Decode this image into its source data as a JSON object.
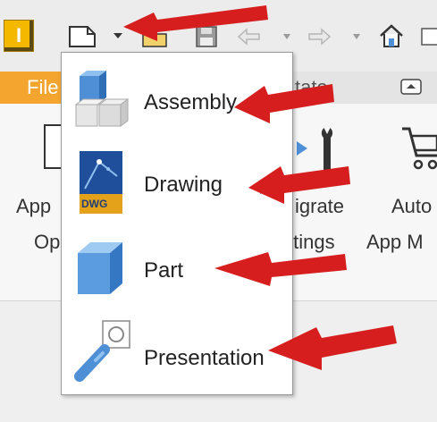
{
  "app": {
    "logo_letter": "I"
  },
  "ribbon": {
    "file_tab": "File",
    "tab_partial": "tate",
    "buttons": [
      {
        "line1": "App",
        "line2": "Op"
      },
      {
        "line1": "igrate",
        "line2": "ttings"
      },
      {
        "line1": "Auto",
        "line2": "App M"
      }
    ]
  },
  "new_menu": {
    "items": [
      {
        "label": "Assembly",
        "icon": "assembly-icon"
      },
      {
        "label": "Drawing",
        "icon": "drawing-icon",
        "badge": "DWG",
        "has_submenu": true
      },
      {
        "label": "Part",
        "icon": "part-icon"
      },
      {
        "label": "Presentation",
        "icon": "presentation-icon"
      }
    ]
  },
  "colors": {
    "file_tab": "#f3a530",
    "arrow": "#d61e1e",
    "icon_blue": "#4f8fd6",
    "dwg_badge": "#e3a21a"
  }
}
